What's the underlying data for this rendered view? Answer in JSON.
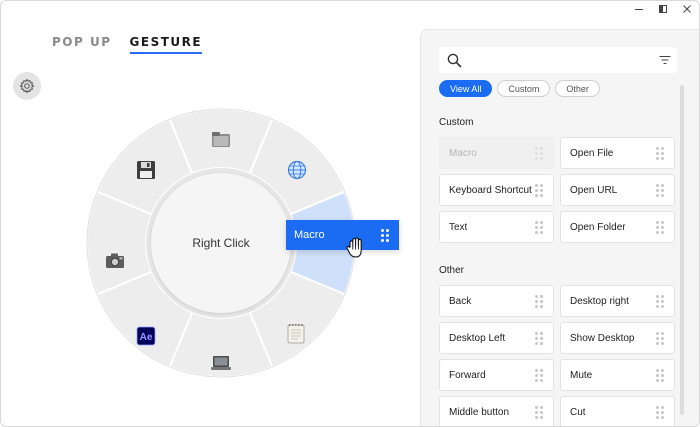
{
  "window": {
    "controls": [
      "minimize",
      "restore",
      "close"
    ]
  },
  "modes": {
    "popup": "POP UP",
    "gesture": "GESTURE",
    "active": "gesture"
  },
  "wheel": {
    "center_label": "Right Click",
    "segments": [
      {
        "icon": "folder-icon"
      },
      {
        "icon": "globe-icon"
      },
      {
        "icon": "macro-slot",
        "highlighted": true
      },
      {
        "icon": "notepad-icon"
      },
      {
        "icon": "laptop-icon"
      },
      {
        "icon": "after-effects-icon",
        "text": "Ae"
      },
      {
        "icon": "camera-icon"
      },
      {
        "icon": "floppy-disk-icon"
      }
    ]
  },
  "drag_item": {
    "label": "Macro"
  },
  "panel": {
    "search": {
      "placeholder": "",
      "value": ""
    },
    "filters": [
      "View All",
      "Custom",
      "Other"
    ],
    "active_filter": "View All",
    "sections": [
      {
        "title": "Custom",
        "items": [
          "Macro",
          "Open File",
          "Keyboard Shortcut",
          "Open URL",
          "Text",
          "Open Folder"
        ],
        "disabled": [
          "Macro"
        ]
      },
      {
        "title": "Other",
        "items": [
          "Back",
          "Desktop right",
          "Desktop Left",
          "Show Desktop",
          "Forward",
          "Mute",
          "Middle button",
          "Cut"
        ]
      }
    ]
  },
  "colors": {
    "accent": "#1b6cf2",
    "highlight_segment": "#cfe0fa",
    "wheel_bg": "#ededed"
  }
}
